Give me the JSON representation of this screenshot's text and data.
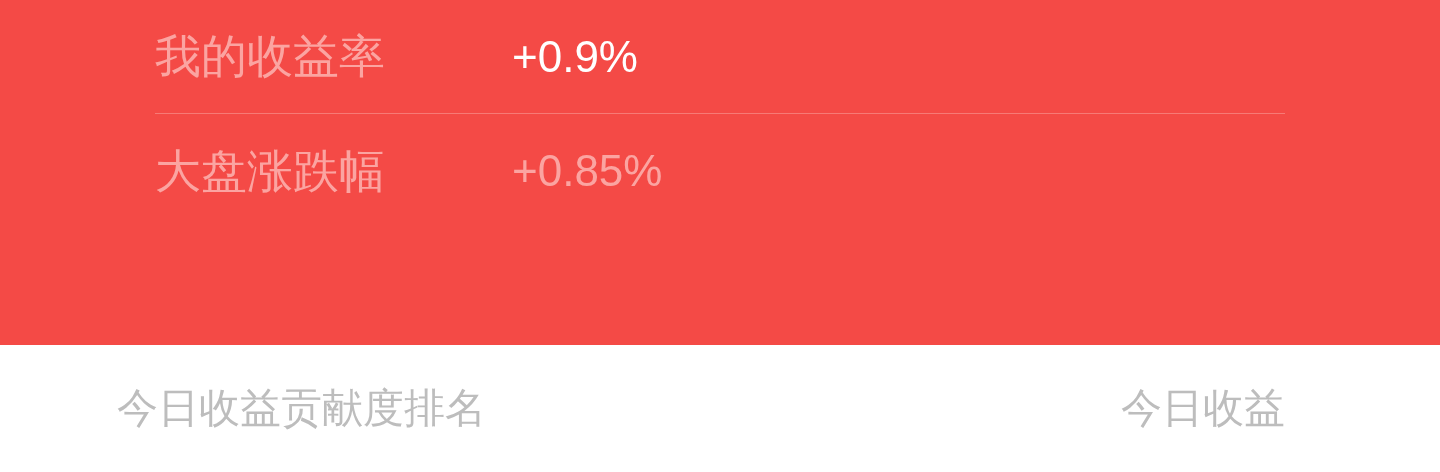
{
  "metrics": [
    {
      "label": "我的收益率",
      "value": "+0.9%",
      "emphasized": true
    },
    {
      "label": "大盘涨跌幅",
      "value": "+0.85%",
      "emphasized": false
    }
  ],
  "ranking_header": {
    "title": "今日收益贡献度排名",
    "column": "今日收益"
  }
}
